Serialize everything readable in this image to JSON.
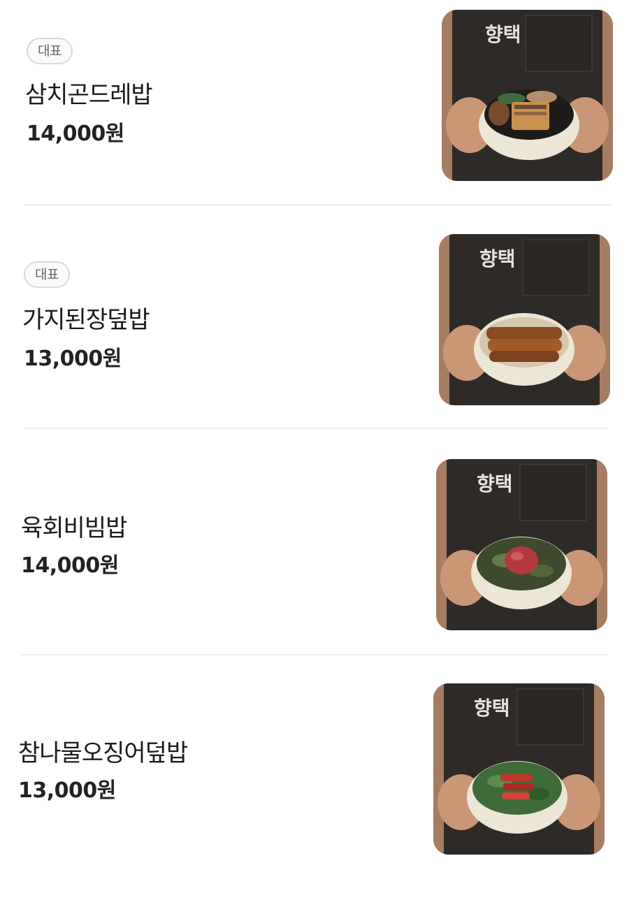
{
  "menu": {
    "items": [
      {
        "badge": "대표",
        "name": "삼치곤드레밥",
        "price": "14,000원",
        "image": {
          "apron_text": "향택",
          "topping": "grilled-mackerel"
        }
      },
      {
        "badge": "대표",
        "name": "가지된장덮밥",
        "price": "13,000원",
        "image": {
          "apron_text": "향택",
          "topping": "grilled-eggplant"
        }
      },
      {
        "badge": "",
        "name": "육회비빔밥",
        "price": "14,000원",
        "image": {
          "apron_text": "향택",
          "topping": "beef-tartare"
        }
      },
      {
        "badge": "",
        "name": "참나물오징어덮밥",
        "price": "13,000원",
        "image": {
          "apron_text": "향택",
          "topping": "spicy-squid"
        }
      }
    ]
  },
  "colors": {
    "apron": "#2e2a28",
    "bowl": "#ece6d6",
    "divider": "#eeeeee"
  }
}
